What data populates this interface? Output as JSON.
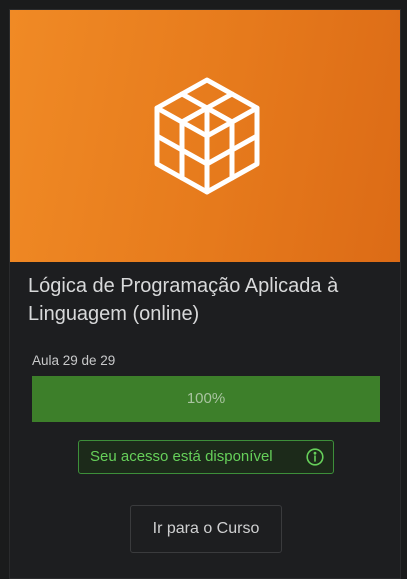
{
  "course": {
    "banner_icon": "cubes-icon",
    "banner_color": "#e67a1c",
    "title": "Lógica de Programação Aplicada à Linguagem (online)"
  },
  "progress": {
    "lesson_text": "Aula 29 de 29",
    "percent": 100,
    "percent_label": "100%",
    "bar_color": "#3d7f2a"
  },
  "access": {
    "label": "Seu acesso está disponível",
    "icon": "info-icon",
    "color": "#66d05a"
  },
  "actions": {
    "go_to_course": "Ir para o Curso"
  }
}
